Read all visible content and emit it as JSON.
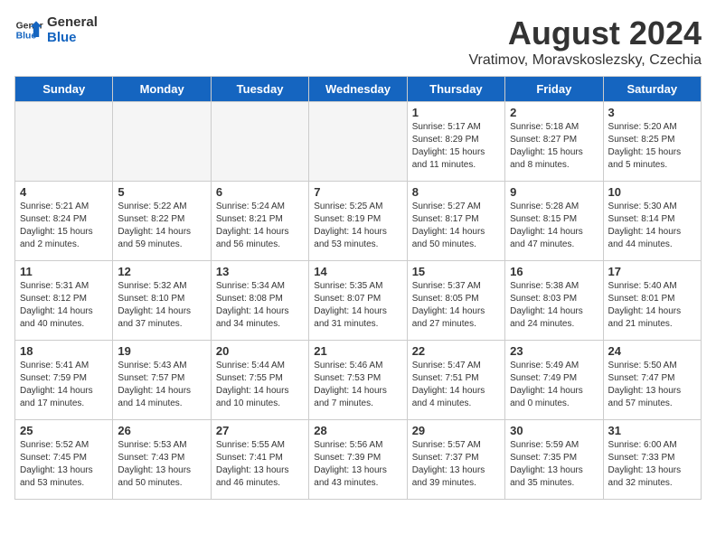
{
  "header": {
    "logo_line1": "General",
    "logo_line2": "Blue",
    "month_year": "August 2024",
    "location": "Vratimov, Moravskoslezsky, Czechia"
  },
  "days_of_week": [
    "Sunday",
    "Monday",
    "Tuesday",
    "Wednesday",
    "Thursday",
    "Friday",
    "Saturday"
  ],
  "weeks": [
    [
      {
        "day": "",
        "info": ""
      },
      {
        "day": "",
        "info": ""
      },
      {
        "day": "",
        "info": ""
      },
      {
        "day": "",
        "info": ""
      },
      {
        "day": "1",
        "info": "Sunrise: 5:17 AM\nSunset: 8:29 PM\nDaylight: 15 hours\nand 11 minutes."
      },
      {
        "day": "2",
        "info": "Sunrise: 5:18 AM\nSunset: 8:27 PM\nDaylight: 15 hours\nand 8 minutes."
      },
      {
        "day": "3",
        "info": "Sunrise: 5:20 AM\nSunset: 8:25 PM\nDaylight: 15 hours\nand 5 minutes."
      }
    ],
    [
      {
        "day": "4",
        "info": "Sunrise: 5:21 AM\nSunset: 8:24 PM\nDaylight: 15 hours\nand 2 minutes."
      },
      {
        "day": "5",
        "info": "Sunrise: 5:22 AM\nSunset: 8:22 PM\nDaylight: 14 hours\nand 59 minutes."
      },
      {
        "day": "6",
        "info": "Sunrise: 5:24 AM\nSunset: 8:21 PM\nDaylight: 14 hours\nand 56 minutes."
      },
      {
        "day": "7",
        "info": "Sunrise: 5:25 AM\nSunset: 8:19 PM\nDaylight: 14 hours\nand 53 minutes."
      },
      {
        "day": "8",
        "info": "Sunrise: 5:27 AM\nSunset: 8:17 PM\nDaylight: 14 hours\nand 50 minutes."
      },
      {
        "day": "9",
        "info": "Sunrise: 5:28 AM\nSunset: 8:15 PM\nDaylight: 14 hours\nand 47 minutes."
      },
      {
        "day": "10",
        "info": "Sunrise: 5:30 AM\nSunset: 8:14 PM\nDaylight: 14 hours\nand 44 minutes."
      }
    ],
    [
      {
        "day": "11",
        "info": "Sunrise: 5:31 AM\nSunset: 8:12 PM\nDaylight: 14 hours\nand 40 minutes."
      },
      {
        "day": "12",
        "info": "Sunrise: 5:32 AM\nSunset: 8:10 PM\nDaylight: 14 hours\nand 37 minutes."
      },
      {
        "day": "13",
        "info": "Sunrise: 5:34 AM\nSunset: 8:08 PM\nDaylight: 14 hours\nand 34 minutes."
      },
      {
        "day": "14",
        "info": "Sunrise: 5:35 AM\nSunset: 8:07 PM\nDaylight: 14 hours\nand 31 minutes."
      },
      {
        "day": "15",
        "info": "Sunrise: 5:37 AM\nSunset: 8:05 PM\nDaylight: 14 hours\nand 27 minutes."
      },
      {
        "day": "16",
        "info": "Sunrise: 5:38 AM\nSunset: 8:03 PM\nDaylight: 14 hours\nand 24 minutes."
      },
      {
        "day": "17",
        "info": "Sunrise: 5:40 AM\nSunset: 8:01 PM\nDaylight: 14 hours\nand 21 minutes."
      }
    ],
    [
      {
        "day": "18",
        "info": "Sunrise: 5:41 AM\nSunset: 7:59 PM\nDaylight: 14 hours\nand 17 minutes."
      },
      {
        "day": "19",
        "info": "Sunrise: 5:43 AM\nSunset: 7:57 PM\nDaylight: 14 hours\nand 14 minutes."
      },
      {
        "day": "20",
        "info": "Sunrise: 5:44 AM\nSunset: 7:55 PM\nDaylight: 14 hours\nand 10 minutes."
      },
      {
        "day": "21",
        "info": "Sunrise: 5:46 AM\nSunset: 7:53 PM\nDaylight: 14 hours\nand 7 minutes."
      },
      {
        "day": "22",
        "info": "Sunrise: 5:47 AM\nSunset: 7:51 PM\nDaylight: 14 hours\nand 4 minutes."
      },
      {
        "day": "23",
        "info": "Sunrise: 5:49 AM\nSunset: 7:49 PM\nDaylight: 14 hours\nand 0 minutes."
      },
      {
        "day": "24",
        "info": "Sunrise: 5:50 AM\nSunset: 7:47 PM\nDaylight: 13 hours\nand 57 minutes."
      }
    ],
    [
      {
        "day": "25",
        "info": "Sunrise: 5:52 AM\nSunset: 7:45 PM\nDaylight: 13 hours\nand 53 minutes."
      },
      {
        "day": "26",
        "info": "Sunrise: 5:53 AM\nSunset: 7:43 PM\nDaylight: 13 hours\nand 50 minutes."
      },
      {
        "day": "27",
        "info": "Sunrise: 5:55 AM\nSunset: 7:41 PM\nDaylight: 13 hours\nand 46 minutes."
      },
      {
        "day": "28",
        "info": "Sunrise: 5:56 AM\nSunset: 7:39 PM\nDaylight: 13 hours\nand 43 minutes."
      },
      {
        "day": "29",
        "info": "Sunrise: 5:57 AM\nSunset: 7:37 PM\nDaylight: 13 hours\nand 39 minutes."
      },
      {
        "day": "30",
        "info": "Sunrise: 5:59 AM\nSunset: 7:35 PM\nDaylight: 13 hours\nand 35 minutes."
      },
      {
        "day": "31",
        "info": "Sunrise: 6:00 AM\nSunset: 7:33 PM\nDaylight: 13 hours\nand 32 minutes."
      }
    ]
  ]
}
